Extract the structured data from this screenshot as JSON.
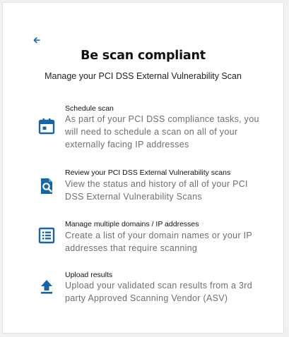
{
  "header": {
    "back_icon": "arrow-left-icon",
    "title": "Be scan compliant",
    "subtitle": "Manage your PCI DSS External Vulnerability Scan"
  },
  "features": [
    {
      "icon": "calendar-icon",
      "title": "Schedule scan",
      "desc_lines": [
        "As part of your PCI DSS compliance tasks, you",
        "will need to schedule a scan on all of your",
        "externally facing IP addresses"
      ]
    },
    {
      "icon": "document-search-icon",
      "title": "Review your PCI DSS External Vulnerability scans",
      "desc_lines": [
        "View the status and history of all of your PCI",
        "DSS External Vulnerability Scans"
      ]
    },
    {
      "icon": "list-icon",
      "title": "Manage multiple domains / IP addresses",
      "desc_lines": [
        "Create a list of your domain names or your IP",
        "addresses that require scanning"
      ]
    },
    {
      "icon": "upload-icon",
      "title": "Upload results",
      "desc_lines": [
        "Upload your validated scan results from a 3rd",
        "party Approved Scanning Vendor (ASV)"
      ]
    }
  ],
  "colors": {
    "accent": "#1466a8",
    "card_bg": "#ffffff",
    "page_bg": "#f1f1f1"
  }
}
